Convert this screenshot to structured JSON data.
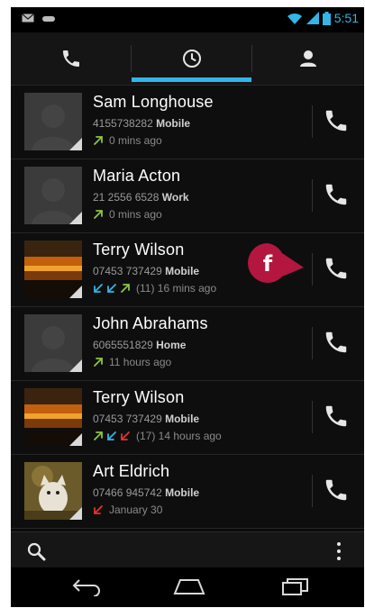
{
  "status": {
    "time": "5:51",
    "icons": [
      "mail-icon",
      "voicemail-icon",
      "wifi-icon",
      "signal-icon",
      "battery-icon"
    ]
  },
  "tabs": [
    {
      "name": "phone-tab",
      "icon": "phone-icon"
    },
    {
      "name": "recent-tab",
      "icon": "clock-icon",
      "selected": true
    },
    {
      "name": "contacts-tab",
      "icon": "person-icon"
    }
  ],
  "calls": [
    {
      "name": "Sam Longhouse",
      "number": "4155738282",
      "type": "Mobile",
      "when": "0 mins ago",
      "arrows": [
        "outgoing"
      ],
      "avatar": "placeholder"
    },
    {
      "name": "Maria Acton",
      "number": "21 2556 6528",
      "type": "Work",
      "when": "0 mins ago",
      "arrows": [
        "outgoing"
      ],
      "avatar": "placeholder"
    },
    {
      "name": "Terry Wilson",
      "number": "07453 737429",
      "type": "Mobile",
      "when": "(11) 16 mins ago",
      "arrows": [
        "incoming",
        "incoming",
        "outgoing"
      ],
      "avatar": "sunset"
    },
    {
      "name": "John Abrahams",
      "number": "6065551829",
      "type": "Home",
      "when": "11 hours ago",
      "arrows": [
        "outgoing"
      ],
      "avatar": "placeholder"
    },
    {
      "name": "Terry Wilson",
      "number": "07453 737429",
      "type": "Mobile",
      "when": "(17) 14 hours ago",
      "arrows": [
        "outgoing",
        "incoming",
        "missed"
      ],
      "avatar": "sunset"
    },
    {
      "name": "Art Eldrich",
      "number": "07466 945742",
      "type": "Mobile",
      "when": "January 30",
      "arrows": [
        "missed"
      ],
      "avatar": "cat"
    }
  ],
  "callout": {
    "label": "f",
    "color": "#b3163f"
  },
  "colors": {
    "accent": "#33b5e5",
    "outgoing": "#8cc63f",
    "incoming": "#33b5e5",
    "missed": "#e8332a"
  },
  "bottom": {
    "left_icon": "search-icon",
    "right_icon": "overflow-menu-icon"
  },
  "nav": [
    "back-icon",
    "home-icon",
    "recents-icon"
  ]
}
